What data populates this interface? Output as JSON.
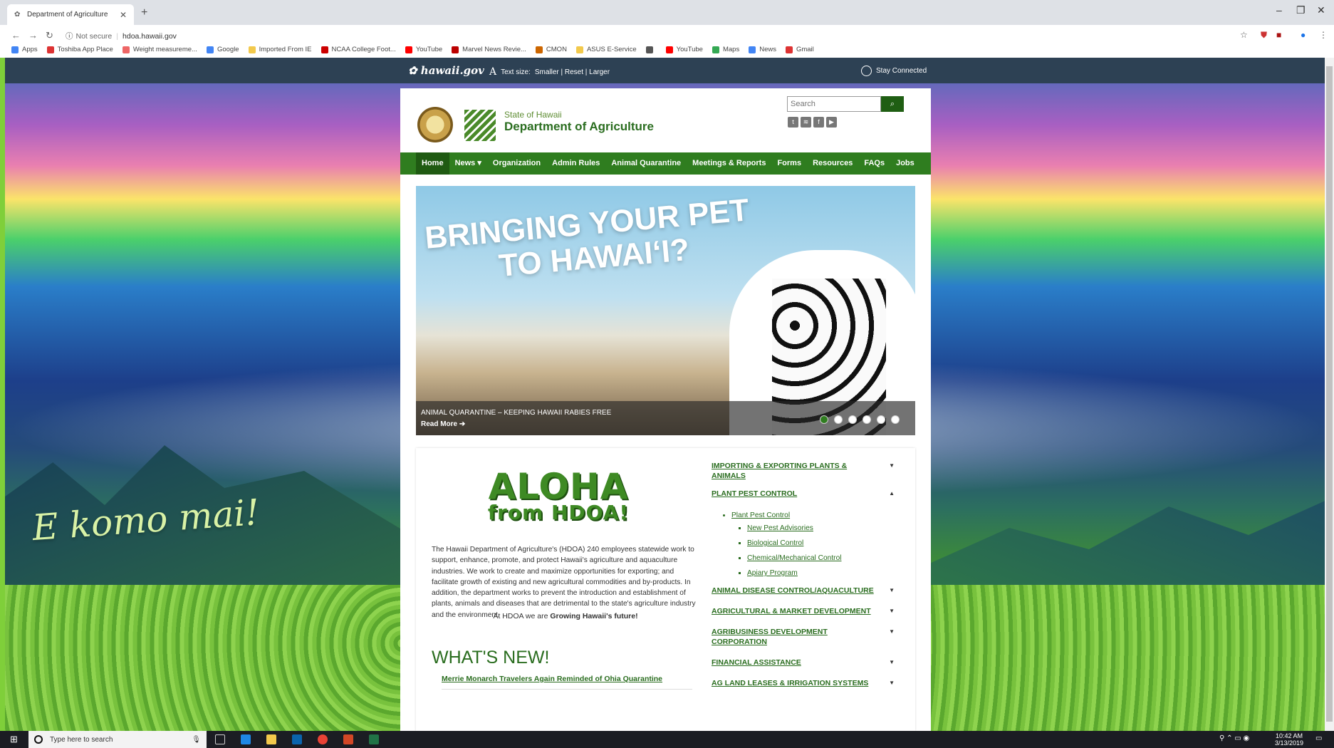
{
  "browser": {
    "tab_title": "Department of Agriculture",
    "url_security": "Not secure",
    "url": "hdoa.hawaii.gov",
    "bookmarks": [
      {
        "label": "Apps",
        "color": "#4285f4"
      },
      {
        "label": "Toshiba App Place",
        "color": "#d33"
      },
      {
        "label": "Weight measureme...",
        "color": "#e66"
      },
      {
        "label": "Google",
        "color": "#4285f4"
      },
      {
        "label": "Imported From IE",
        "color": "#f2c94c"
      },
      {
        "label": "NCAA College Foot...",
        "color": "#c00"
      },
      {
        "label": "YouTube",
        "color": "#f00"
      },
      {
        "label": "Marvel News Revie...",
        "color": "#b00"
      },
      {
        "label": "CMON",
        "color": "#c60"
      },
      {
        "label": "ASUS E-Service",
        "color": "#f2c94c"
      },
      {
        "label": "",
        "color": "#555"
      },
      {
        "label": "YouTube",
        "color": "#f00"
      },
      {
        "label": "Maps",
        "color": "#34a853"
      },
      {
        "label": "News",
        "color": "#4285f4"
      },
      {
        "label": "Gmail",
        "color": "#d33"
      }
    ]
  },
  "gov_bar": {
    "logo": "hawaii.gov",
    "text_size_label": "Text size:",
    "text_size_options": "Smaller | Reset | Larger",
    "stay_connected": "Stay Connected"
  },
  "header": {
    "state": "State of Hawaii",
    "dept": "Department of Agriculture",
    "search_placeholder": "Search"
  },
  "nav": [
    "Home",
    "News ▾",
    "Organization",
    "Admin Rules",
    "Animal Quarantine",
    "Meetings & Reports",
    "Forms",
    "Resources",
    "FAQs",
    "Jobs"
  ],
  "slide": {
    "headline_1": "BRINGING YOUR PET",
    "headline_2": "TO HAWAI‘I?",
    "caption": "Animal Quarantine – Keeping Hawaii Rabies Free",
    "read_more": "Read More ➔"
  },
  "bg_text": "E komo mai!",
  "aloha": {
    "line1": "ALOHA",
    "line2": "from HDOA!"
  },
  "intro": "The Hawaii Department of Agriculture's (HDOA) 240 employees statewide work to support, enhance, promote, and protect Hawaii's agriculture and aquaculture industries. We work to create and maximize opportunities for exporting; and facilitate growth of existing and new agricultural commodities and by-products. In addition, the department works to prevent the introduction and establishment of plants, animals and diseases that are detrimental to the state's agriculture industry and the environment.",
  "growing_prefix": "At HDOA we are ",
  "growing_bold": "Growing Hawaii's future!",
  "whats_new": {
    "title": "WHAT'S NEW!",
    "item": "Merrie Monarch Travelers Again Reminded of Ohia Quarantine"
  },
  "accordion": {
    "imp": "IMPORTING & EXPORTING PLANTS & ANIMALS",
    "ppc": "PLANT PEST CONTROL",
    "ppc_link": "Plant Pest Control",
    "sub": [
      "New Pest Advisories",
      "Biological Control",
      "Chemical/Mechanical Control",
      "Apiary Program"
    ],
    "adc": "ANIMAL DISEASE CONTROL/AQUACULTURE",
    "amd": "AGRICULTURAL & MARKET DEVELOPMENT",
    "abd": "AGRIBUSINESS DEVELOPMENT CORPORATION",
    "fa": "FINANCIAL ASSISTANCE",
    "ag": "AG LAND LEASES & IRRIGATION SYSTEMS"
  },
  "taskbar": {
    "search": "Type here to search",
    "time": "10:42 AM",
    "date": "3/13/2019"
  }
}
